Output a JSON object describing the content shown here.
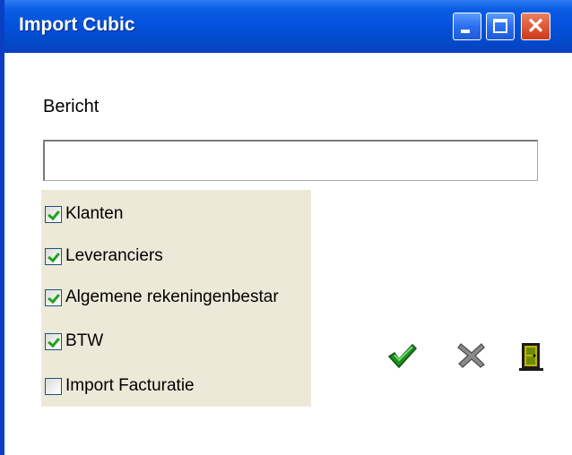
{
  "window": {
    "title": "Import Cubic"
  },
  "titlebar": {
    "close_glyph": "✕"
  },
  "form": {
    "bericht_label": "Bericht",
    "bericht_value": "",
    "checkboxes": [
      {
        "label": "Klanten",
        "checked": true
      },
      {
        "label": "Leveranciers",
        "checked": true
      },
      {
        "label": "Algemene rekeningenbestar",
        "checked": true
      },
      {
        "label": "BTW",
        "checked": true
      },
      {
        "label": "Import Facturatie",
        "checked": false
      }
    ]
  },
  "actions": {
    "ok_icon": "green-checkmark-icon",
    "cancel_icon": "gray-x-icon",
    "exit_icon": "door-exit-icon"
  },
  "colors": {
    "titlebar": "#0452dd",
    "panel": "#ece9d8",
    "check": "#21a121",
    "close_button": "#df5a36"
  }
}
